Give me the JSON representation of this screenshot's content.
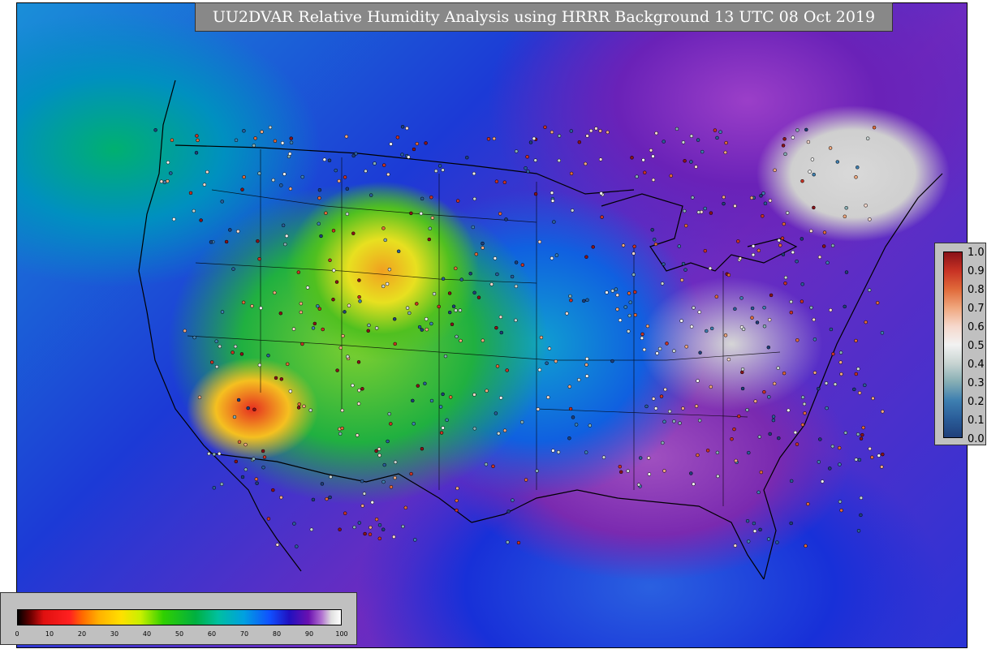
{
  "title": "UU2DVAR Relative Humidity Analysis using HRRR Background 13 UTC 08 Oct 2019",
  "legend": {
    "ticks": [
      "1.0",
      "0.9",
      "0.8",
      "0.7",
      "0.6",
      "0.5",
      "0.4",
      "0.3",
      "0.2",
      "0.1",
      "0.0"
    ],
    "colors": [
      "#1f3f7a",
      "#2a5d99",
      "#3e7fb0",
      "#86aeb4",
      "#c8d4d2",
      "#f2f2f2",
      "#f6d8cc",
      "#f0a77e",
      "#e06a3a",
      "#c83224",
      "#8a1218"
    ]
  },
  "colorbar": {
    "ticks": [
      "0",
      "10",
      "20",
      "30",
      "40",
      "50",
      "60",
      "70",
      "80",
      "90",
      "100"
    ]
  },
  "map": {
    "region": "CONUS",
    "field": "relative humidity",
    "colors": {
      "coast_lines": "#000000",
      "state_lines": "#000000",
      "obs_marker_fill": "#d8d8d8"
    }
  }
}
